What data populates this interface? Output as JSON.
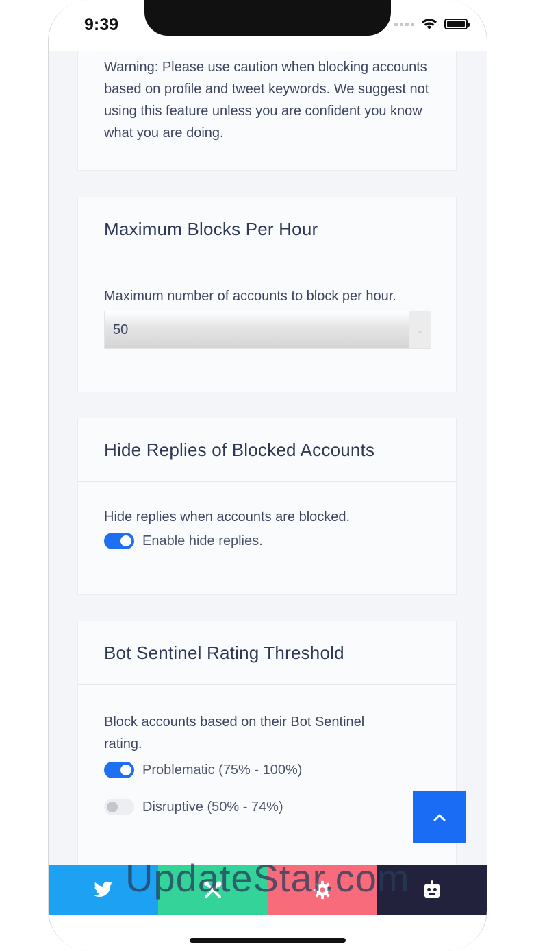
{
  "status_bar": {
    "time": "9:39"
  },
  "warning_card": {
    "text": "Warning: Please use caution when blocking accounts based on profile and tweet keywords. We suggest not using this feature unless you are confident you know what you are doing."
  },
  "max_blocks_card": {
    "title": "Maximum Blocks Per Hour",
    "description": "Maximum number of accounts to block per hour.",
    "select_value": "50"
  },
  "hide_replies_card": {
    "title": "Hide Replies of Blocked Accounts",
    "description": "Hide replies when accounts are blocked.",
    "toggle_label": "Enable hide replies.",
    "toggle_state": "on"
  },
  "rating_card": {
    "title": "Bot Sentinel Rating Threshold",
    "description": "Block accounts based on their Bot Sentinel rating.",
    "options": [
      {
        "label": "Problematic (75% - 100%)",
        "state": "on"
      },
      {
        "label": "Disruptive (50% - 74%)",
        "state": "off"
      }
    ]
  },
  "tab_bar": {
    "tabs": [
      {
        "icon": "twitter-bird-icon",
        "color": "#1da1f2"
      },
      {
        "icon": "tools-icon",
        "color": "#34d39a"
      },
      {
        "icon": "gear-icon",
        "color": "#f76b7b"
      },
      {
        "icon": "robot-icon",
        "color": "#22223c"
      }
    ]
  },
  "watermark": "UpdateStar.com",
  "colors": {
    "accent": "#1f6ff2",
    "scroll_button": "#1b6cf5",
    "title_text": "#2e3a55"
  }
}
